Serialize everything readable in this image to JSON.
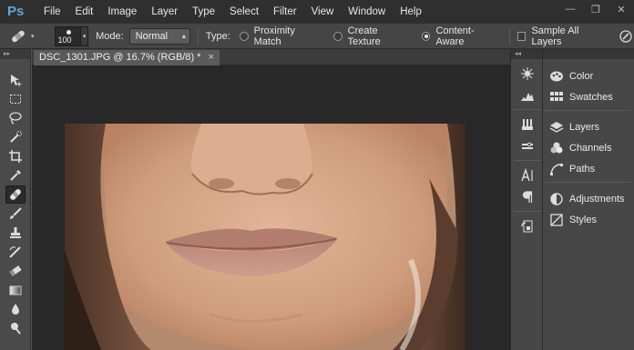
{
  "app": {
    "logo_text": "Ps"
  },
  "menu": [
    "File",
    "Edit",
    "Image",
    "Layer",
    "Type",
    "Select",
    "Filter",
    "View",
    "Window",
    "Help"
  ],
  "window_controls": {
    "minimize": "—",
    "restore": "❐",
    "close": "✕"
  },
  "options": {
    "brush_size": "100",
    "mode_label": "Mode:",
    "mode_value": "Normal",
    "type_label": "Type:",
    "type_options": [
      {
        "label": "Proximity Match",
        "selected": false
      },
      {
        "label": "Create Texture",
        "selected": false
      },
      {
        "label": "Content-Aware",
        "selected": true
      }
    ],
    "sample_all_layers": "Sample All Layers"
  },
  "toolbar": {
    "collapse_glyph": "▸▸"
  },
  "document": {
    "tab_title": "DSC_1301.JPG @ 16.7% (RGB/8) *",
    "close_glyph": "×"
  },
  "dock_narrow": {
    "collapse_glyph": "◂◂"
  },
  "panels": [
    {
      "group": 1,
      "label": "Color",
      "icon": "color-palette-icon"
    },
    {
      "group": 1,
      "label": "Swatches",
      "icon": "swatches-grid-icon"
    },
    {
      "group": 2,
      "label": "Layers",
      "icon": "layers-stack-icon"
    },
    {
      "group": 2,
      "label": "Channels",
      "icon": "channels-circles-icon"
    },
    {
      "group": 2,
      "label": "Paths",
      "icon": "paths-pen-icon"
    },
    {
      "group": 3,
      "label": "Adjustments",
      "icon": "adjustments-half-circle-icon"
    },
    {
      "group": 3,
      "label": "Styles",
      "icon": "styles-fx-icon"
    }
  ],
  "colors": {
    "menubar": "#2f2f2f",
    "options": "#454545",
    "panel": "#474747",
    "canvas_bg": "#282828",
    "ps_blue": "#5aa7e0"
  }
}
